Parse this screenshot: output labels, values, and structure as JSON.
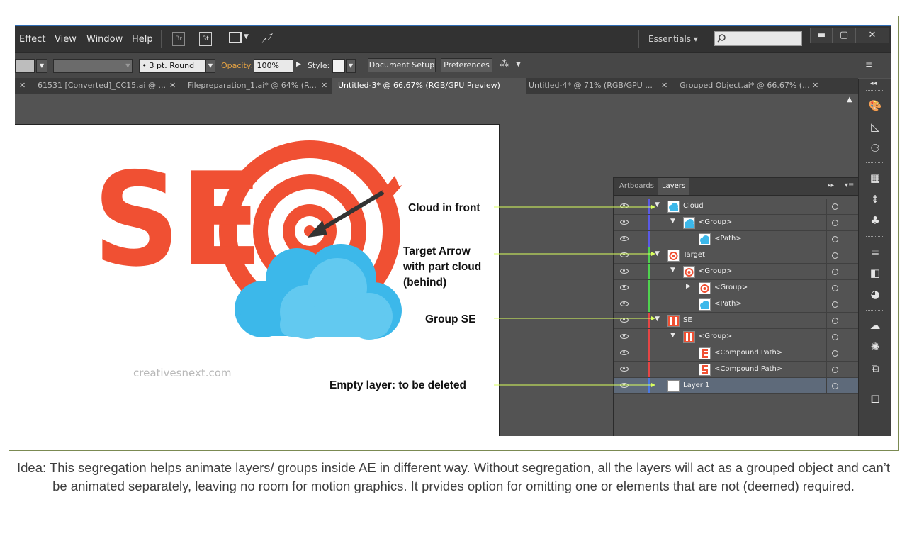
{
  "menubar": {
    "items": [
      "Effect",
      "View",
      "Window",
      "Help"
    ],
    "bridge_icon": "Br",
    "stock_icon": "St",
    "workspace": "Essentials"
  },
  "control_bar": {
    "stroke_profile": "3 pt. Round",
    "opacity_label": "Opacity:",
    "opacity_value": "100%",
    "style_label": "Style:",
    "document_setup": "Document Setup",
    "preferences": "Preferences"
  },
  "tabs": [
    {
      "label": "61531 [Converted]_CC15.ai @ ...",
      "active": false
    },
    {
      "label": "Filepreparation_1.ai* @ 64% (R...",
      "active": false
    },
    {
      "label": "Untitled-3* @ 66.67% (RGB/GPU Preview)",
      "active": true
    },
    {
      "label": "Untitled-4* @ 71% (RGB/GPU ...",
      "active": false
    },
    {
      "label": "Grouped Object.ai* @ 66.67% (...",
      "active": false
    }
  ],
  "artwork": {
    "logo_letters": "SE",
    "watermark": "creativesnext.com"
  },
  "annotations": {
    "cloud": "Cloud in front",
    "target_line1": "Target Arrow",
    "target_line2": "with part cloud",
    "target_line3": "(behind)",
    "group_se": "Group SE",
    "empty": "Empty layer: to be deleted"
  },
  "panel": {
    "tabs": [
      "Artboards",
      "Layers"
    ],
    "rows": [
      {
        "label": "Cloud",
        "level": 0,
        "expanded": true,
        "color": "#5a5ae6",
        "thumb": "cloud"
      },
      {
        "label": "<Group>",
        "level": 1,
        "expanded": true,
        "color": "#5a5ae6",
        "thumb": "cloud"
      },
      {
        "label": "<Path>",
        "level": 2,
        "expanded": null,
        "color": "#5a5ae6",
        "thumb": "cloud"
      },
      {
        "label": "Target",
        "level": 0,
        "expanded": true,
        "color": "#4fd24f",
        "thumb": "target"
      },
      {
        "label": "<Group>",
        "level": 1,
        "expanded": true,
        "color": "#4fd24f",
        "thumb": "target"
      },
      {
        "label": "<Group>",
        "level": 2,
        "expanded": false,
        "color": "#4fd24f",
        "thumb": "target"
      },
      {
        "label": "<Path>",
        "level": 2,
        "expanded": null,
        "color": "#4fd24f",
        "thumb": "cloud"
      },
      {
        "label": "SE",
        "level": 0,
        "expanded": true,
        "color": "#e64545",
        "thumb": "se"
      },
      {
        "label": "<Group>",
        "level": 1,
        "expanded": true,
        "color": "#e64545",
        "thumb": "se"
      },
      {
        "label": "<Compound Path>",
        "level": 2,
        "expanded": null,
        "color": "#e64545",
        "thumb": "e"
      },
      {
        "label": "<Compound Path>",
        "level": 2,
        "expanded": null,
        "color": "#e64545",
        "thumb": "s"
      },
      {
        "label": "Layer 1",
        "level": 0,
        "expanded": null,
        "color": "#4a7ae6",
        "thumb": "blank",
        "selected": true
      }
    ]
  },
  "caption": "Idea: This segregation helps animate layers/ groups inside AE in different way. Without segregation, all the layers will act as a grouped object and can’t be animated separately, leaving no room for motion graphics. It prvides option for omitting one or elements that are not (deemed) required.",
  "colors": {
    "accent_red": "#f05033",
    "cloud_blue": "#3cb8ea",
    "callout_line": "#d9ff5e"
  }
}
